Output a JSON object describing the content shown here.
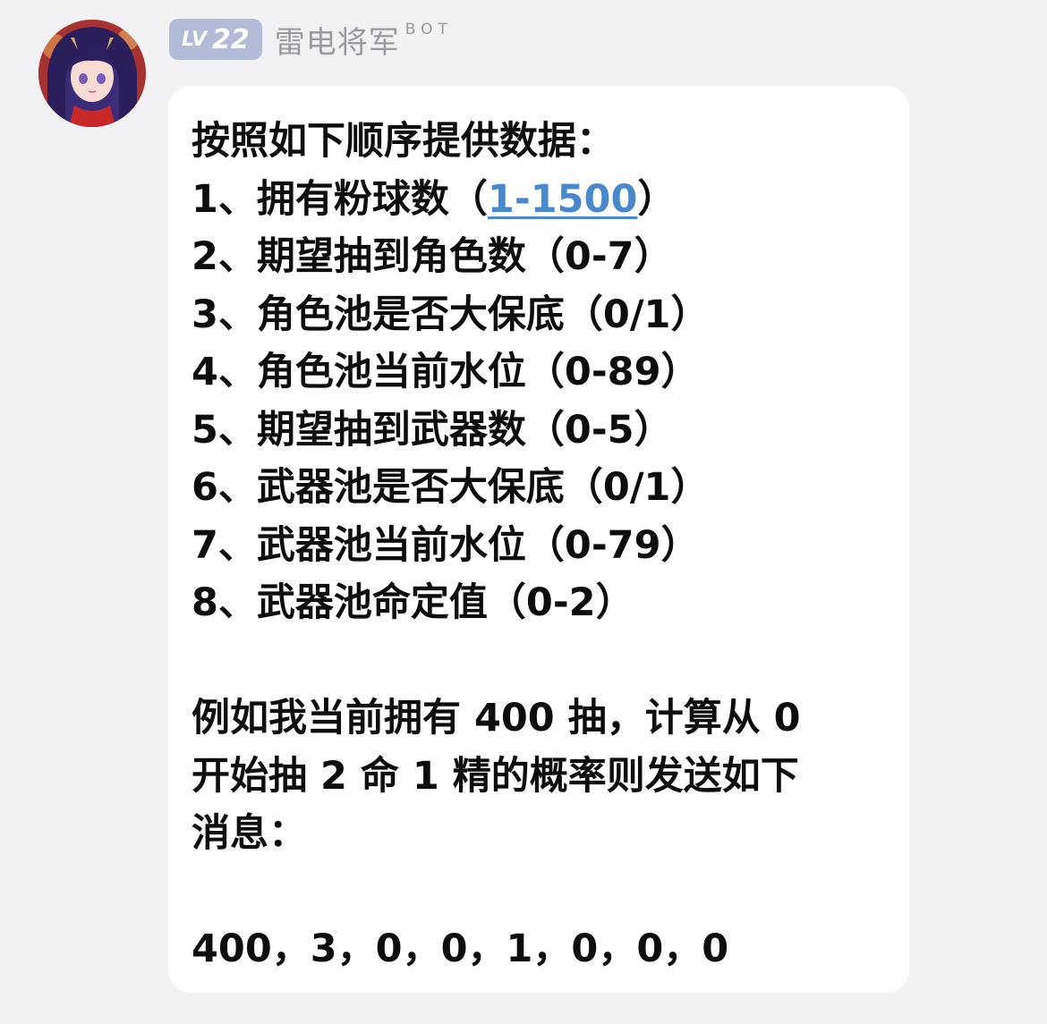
{
  "sender": {
    "level_prefix": "LV",
    "level_number": "22",
    "name": "雷电将军",
    "tag": "BOT",
    "avatar_icon": "anime-character-avatar"
  },
  "message": {
    "intro": "按照如下顺序提供数据：",
    "item1_prefix": "1、拥有粉球数（",
    "item1_link": "1-1500",
    "item1_suffix": "）",
    "item2": "2、期望抽到角色数（0-7）",
    "item3": "3、角色池是否大保底（0/1）",
    "item4": "4、角色池当前水位（0-89）",
    "item5": "5、期望抽到武器数（0-5）",
    "item6": "6、武器池是否大保底（0/1）",
    "item7": "7、武器池当前水位（0-79）",
    "item8": "8、武器池命定值（0-2）",
    "example_line1": "例如我当前拥有 400 抽，计算从 0",
    "example_line2": "开始抽 2 命 1 精的概率则发送如下",
    "example_line3": "消息：",
    "example_message": "400，3，0，0，1，0，0，0"
  },
  "colors": {
    "background": "#f2f2f5",
    "bubble": "#ffffff",
    "level_badge": "#b2bcd6",
    "link": "#4a88cc",
    "name": "#9a9aa0"
  }
}
